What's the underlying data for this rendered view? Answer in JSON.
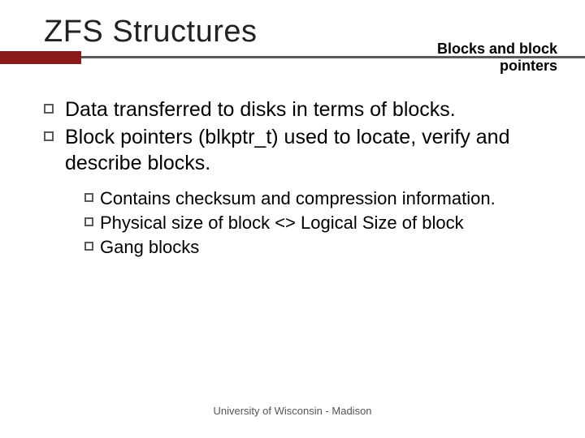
{
  "title": "ZFS Structures",
  "subtitle_line1": "Blocks and block",
  "subtitle_line2": "pointers",
  "bullets": [
    "Data transferred to disks in terms of blocks.",
    "Block pointers (blkptr_t) used to locate, verify and describe blocks."
  ],
  "sub_bullets": [
    "Contains checksum and compression information.",
    "Physical size of block <> Logical Size of block",
    "Gang blocks"
  ],
  "footer": "University of Wisconsin - Madison"
}
